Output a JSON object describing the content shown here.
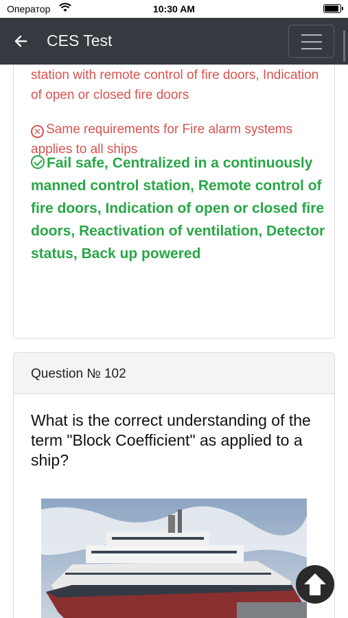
{
  "status_bar": {
    "carrier": "Оператор",
    "time": "10:30 AM"
  },
  "navbar": {
    "title": "CES Test"
  },
  "prev_question": {
    "wrong_answers": [
      "station with remote control of fire doors, Indication of open or closed fire doors",
      "Same requirements for Fire alarm systems applies to all ships"
    ],
    "correct_answer": "Fail safe, Centralized in a continuously manned control station, Remote control of fire doors, Indication of open or closed fire doors, Reactivation of ventilation, Detector status, Back up powered"
  },
  "question": {
    "header": "Question № 102",
    "text": "What is the correct understanding of the term \"Block Coefficient\" as applied to a ship?"
  },
  "colors": {
    "wrong": "#d9534f",
    "correct": "#28a745",
    "navbar": "#343a40"
  },
  "icons": [
    "wifi-icon",
    "battery-icon",
    "back-arrow-icon",
    "hamburger-menu-icon",
    "x-circle-icon",
    "check-circle-icon",
    "scroll-top-arrow-icon"
  ]
}
